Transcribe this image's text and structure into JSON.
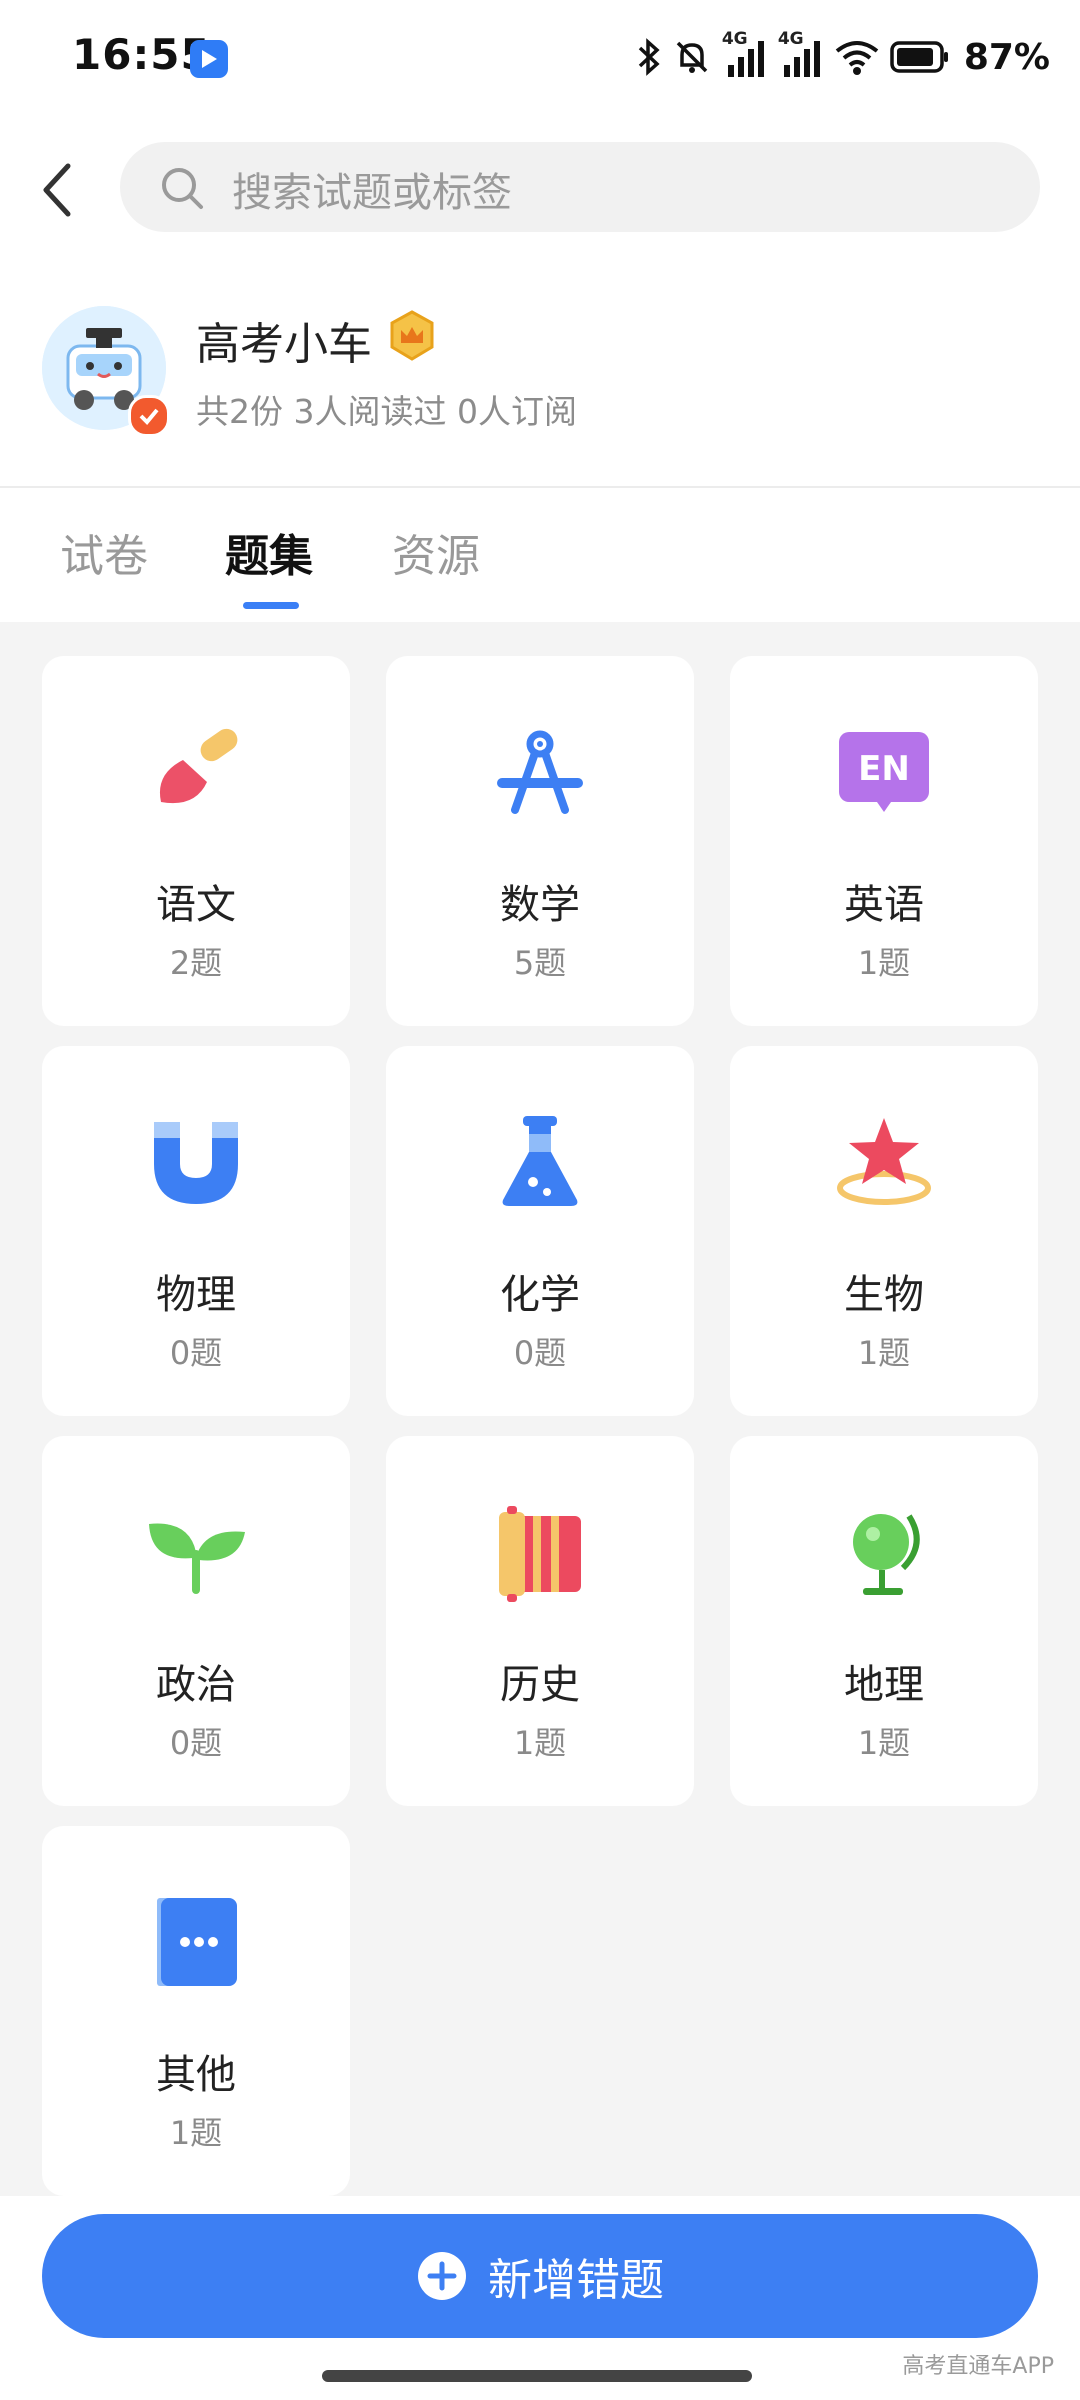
{
  "status_bar": {
    "time": "16:55",
    "network_labels": [
      "4G",
      "4G"
    ],
    "battery": "87%"
  },
  "search": {
    "placeholder": "搜索试题或标签"
  },
  "profile": {
    "name": "高考小车",
    "stats": "共2份 3人阅读过 0人订阅"
  },
  "tabs": [
    {
      "label": "试卷"
    },
    {
      "label": "题集"
    },
    {
      "label": "资源"
    }
  ],
  "active_tab": "题集",
  "subjects": [
    {
      "name": "语文",
      "count": "2题",
      "icon": "brush-icon"
    },
    {
      "name": "数学",
      "count": "5题",
      "icon": "compass-icon"
    },
    {
      "name": "英语",
      "count": "1题",
      "icon": "en-icon"
    },
    {
      "name": "物理",
      "count": "0题",
      "icon": "magnet-icon"
    },
    {
      "name": "化学",
      "count": "0题",
      "icon": "flask-icon"
    },
    {
      "name": "生物",
      "count": "1题",
      "icon": "star-ring-icon"
    },
    {
      "name": "政治",
      "count": "0题",
      "icon": "sprout-icon"
    },
    {
      "name": "历史",
      "count": "1题",
      "icon": "scroll-icon"
    },
    {
      "name": "地理",
      "count": "1题",
      "icon": "globe-icon"
    },
    {
      "name": "其他",
      "count": "1题",
      "icon": "more-icon"
    }
  ],
  "actions": {
    "add_label": "新增错题"
  },
  "watermark": "高考直通车APP",
  "colors": {
    "accent": "#3d7ff3",
    "background": "#f4f4f4"
  }
}
